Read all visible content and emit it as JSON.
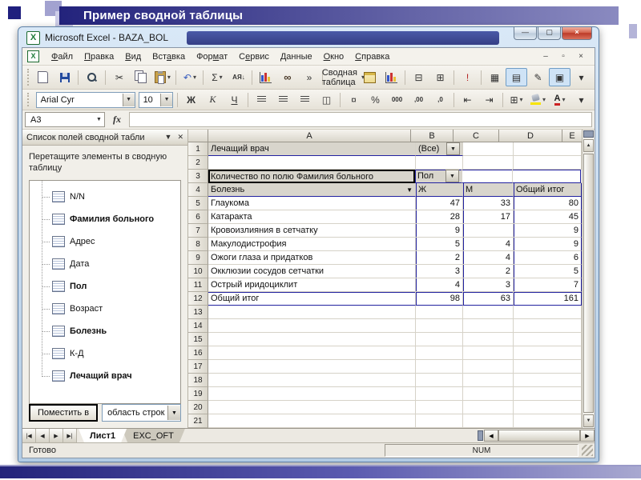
{
  "slide": {
    "title": "Пример сводной таблицы"
  },
  "excel_window": {
    "title": "Microsoft Excel - BAZA_BOL",
    "icon_letter": "X",
    "controls": [
      {
        "name": "minimize",
        "glyph": "—"
      },
      {
        "name": "maximize",
        "glyph": "▢"
      },
      {
        "name": "close",
        "glyph": "×"
      }
    ]
  },
  "menu_bar": {
    "items": [
      {
        "label": "Файл",
        "u": 0
      },
      {
        "label": "Правка",
        "u": 0
      },
      {
        "label": "Вид",
        "u": 0
      },
      {
        "label": "Вставка",
        "u": 3
      },
      {
        "label": "Формат",
        "u": 3
      },
      {
        "label": "Сервис",
        "u": 1
      },
      {
        "label": "Данные",
        "u": 0
      },
      {
        "label": "Окно",
        "u": 0
      },
      {
        "label": "Справка",
        "u": 0
      }
    ],
    "mdi_controls": [
      {
        "name": "minimize-workbook",
        "glyph": "–"
      },
      {
        "name": "restore-workbook",
        "glyph": "▫"
      },
      {
        "name": "close-workbook",
        "glyph": "×"
      }
    ]
  },
  "standard_toolbar": {
    "buttons": [
      {
        "name": "new-document",
        "style": "doc"
      },
      {
        "name": "save",
        "style": "save"
      },
      {
        "sep": true
      },
      {
        "name": "print-preview",
        "style": "mag"
      },
      {
        "sep": true
      },
      {
        "name": "cut",
        "glyph": "✂"
      },
      {
        "name": "copy",
        "style": "copy"
      },
      {
        "name": "paste",
        "style": "paste",
        "dd": true
      },
      {
        "sep": true
      },
      {
        "name": "undo",
        "glyph": "↶",
        "color": "#3a5fbf",
        "dd": true
      },
      {
        "sep": true
      },
      {
        "name": "autosum",
        "glyph": "Σ",
        "dd": true
      },
      {
        "name": "sort-ascending",
        "glyph": "АЯ↓",
        "style": "sort"
      },
      {
        "sep": true
      },
      {
        "name": "chart-wizard",
        "style": "chart"
      },
      {
        "name": "find",
        "glyph": "∞",
        "style": "binoc"
      },
      {
        "name": "more-buttons",
        "glyph": "»"
      }
    ]
  },
  "pivot_toolbar": {
    "label": "Сводная таблица",
    "buttons": [
      {
        "name": "pivot-wizard",
        "style": "tablep"
      },
      {
        "name": "pivot-chart-wizard",
        "style": "chart"
      },
      {
        "sep": true
      },
      {
        "name": "hide-detail",
        "glyph": "⊟"
      },
      {
        "name": "show-detail",
        "glyph": "⊞"
      },
      {
        "sep": true
      },
      {
        "name": "refresh-data",
        "glyph": "!",
        "color": "#b22222"
      },
      {
        "sep": true
      },
      {
        "name": "include-hidden-items",
        "glyph": "▦"
      },
      {
        "name": "always-display-items",
        "glyph": "▤",
        "pressed": true
      },
      {
        "name": "field-settings",
        "glyph": "✎"
      },
      {
        "name": "show-field-list",
        "glyph": "▣",
        "pressed": true
      },
      {
        "name": "pivot-toolbar-options",
        "glyph": "▾"
      }
    ]
  },
  "formatting_toolbar": {
    "font_name": "Arial Cyr",
    "font_size": "10",
    "buttons": [
      {
        "name": "bold",
        "glyph": "Ж",
        "cls": "fmt-b"
      },
      {
        "name": "italic",
        "glyph": "К",
        "cls": "fmt-i"
      },
      {
        "name": "underline",
        "glyph": "Ч",
        "cls": "fmt-u"
      },
      {
        "sep": true
      },
      {
        "name": "align-left",
        "style": "lines"
      },
      {
        "name": "align-center",
        "style": "lines"
      },
      {
        "name": "align-right",
        "style": "lines"
      },
      {
        "name": "merge-center",
        "glyph": "◫"
      },
      {
        "sep": true
      },
      {
        "name": "currency",
        "glyph": "¤"
      },
      {
        "name": "percent",
        "glyph": "%"
      },
      {
        "name": "thousands",
        "glyph": "000",
        "style": "num"
      },
      {
        "name": "increase-decimal",
        "glyph": ",00",
        "style": "num"
      },
      {
        "name": "decrease-decimal",
        "glyph": ",0",
        "style": "num"
      },
      {
        "sep": true
      },
      {
        "name": "decrease-indent",
        "glyph": "⇤"
      },
      {
        "name": "increase-indent",
        "glyph": "⇥"
      },
      {
        "sep": true
      },
      {
        "name": "borders",
        "glyph": "⊞",
        "dd": true
      },
      {
        "name": "fill-color",
        "style": "fill",
        "dd": true
      },
      {
        "name": "font-color",
        "glyph": "А",
        "style": "fcol",
        "dd": true
      },
      {
        "name": "fmt-toolbar-options",
        "glyph": "▾"
      }
    ]
  },
  "formula_bar": {
    "name_box": "A3",
    "fx_label": "fx"
  },
  "task_pane": {
    "title": "Список полей сводной табли",
    "hint": "Перетащите элементы в сводную таблицу",
    "fields": [
      {
        "label": "N/N",
        "bold": false
      },
      {
        "label": "Фамилия больного",
        "bold": true
      },
      {
        "label": "Адрес",
        "bold": false
      },
      {
        "label": "Дата",
        "bold": false
      },
      {
        "label": "Пол",
        "bold": true
      },
      {
        "label": "Возраст",
        "bold": false
      },
      {
        "label": "Болезнь",
        "bold": true
      },
      {
        "label": "К-Д",
        "bold": false
      },
      {
        "label": "Лечащий врач",
        "bold": true
      }
    ],
    "add_button": "Поместить в",
    "area_select": "область строк"
  },
  "sheet": {
    "columns": [
      "A",
      "B",
      "C",
      "D",
      "E"
    ],
    "rows": [
      {
        "n": 1,
        "A": "Лечащий врач",
        "B": "(Все)"
      },
      {
        "n": 2
      },
      {
        "n": 3,
        "A": "Количество по полю Фамилия больного",
        "B": "Пол"
      },
      {
        "n": 4,
        "A": "Болезнь",
        "B": "Ж",
        "C": "М",
        "D": "Общий итог"
      },
      {
        "n": 5,
        "A": "Глаукома",
        "B": 47,
        "C": 33,
        "D": 80
      },
      {
        "n": 6,
        "A": "Катаракта",
        "B": 28,
        "C": 17,
        "D": 45
      },
      {
        "n": 7,
        "A": "Кровоизлияния в сетчатку",
        "B": 9,
        "D": 9
      },
      {
        "n": 8,
        "A": "Макулодистрофия",
        "B": 5,
        "C": 4,
        "D": 9
      },
      {
        "n": 9,
        "A": "Ожоги глаза и придатков",
        "B": 2,
        "C": 4,
        "D": 6
      },
      {
        "n": 10,
        "A": "Окклюзии сосудов сетчатки",
        "B": 3,
        "C": 2,
        "D": 5
      },
      {
        "n": 11,
        "A": "Острый иридоциклит",
        "B": 4,
        "C": 3,
        "D": 7
      },
      {
        "n": 12,
        "A": "Общий итог",
        "B": 98,
        "C": 63,
        "D": 161
      },
      {
        "n": 13
      },
      {
        "n": 14
      },
      {
        "n": 15
      },
      {
        "n": 16
      },
      {
        "n": 17
      },
      {
        "n": 18
      },
      {
        "n": 19
      },
      {
        "n": 20
      },
      {
        "n": 21
      }
    ]
  },
  "tabs": {
    "nav": [
      {
        "name": "first-sheet",
        "glyph": "|◀"
      },
      {
        "name": "prev-sheet",
        "glyph": "◀"
      },
      {
        "name": "next-sheet",
        "glyph": "▶"
      },
      {
        "name": "last-sheet",
        "glyph": "▶|"
      }
    ],
    "sheets": [
      {
        "label": "Лист1",
        "active": true
      },
      {
        "label": "EXC_OFT",
        "active": false
      }
    ]
  },
  "status_bar": {
    "ready": "Готово",
    "num": "NUM"
  }
}
